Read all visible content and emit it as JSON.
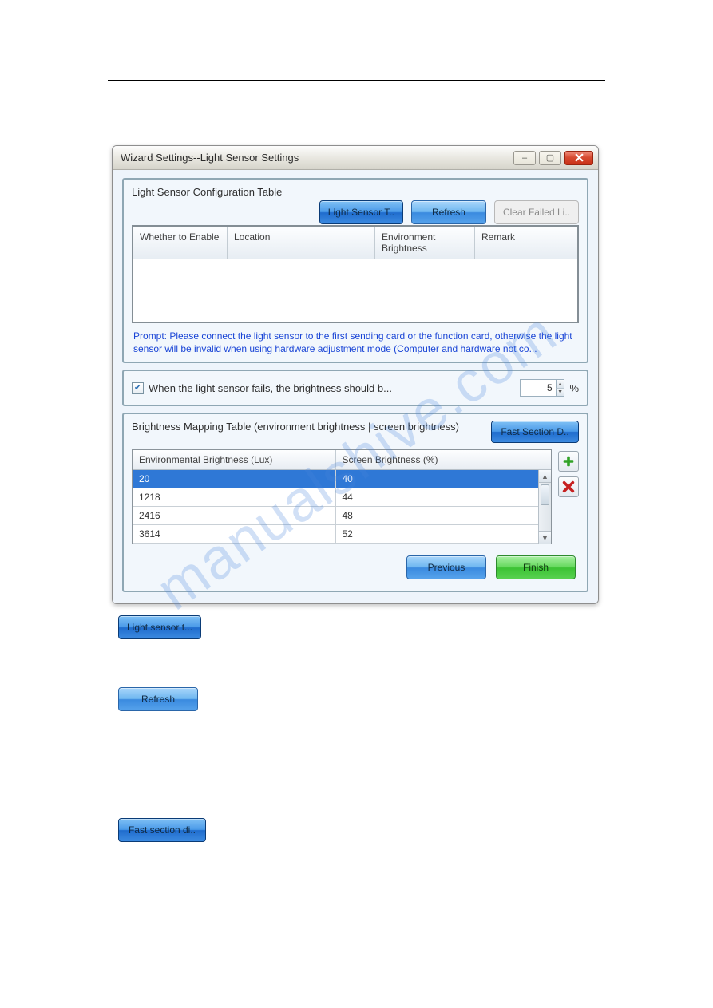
{
  "watermark": "manualshive.com",
  "dialog": {
    "title": "Wizard Settings--Light Sensor Settings",
    "window_controls": {
      "minimize": "–",
      "maximize": "▢",
      "close": "X"
    },
    "section1_title": "Light Sensor Configuration Table",
    "buttons": {
      "light_sensor_test": "Light Sensor T..",
      "refresh": "Refresh",
      "clear_failed": "Clear Failed Li.."
    },
    "config_table": {
      "headers": {
        "enable": "Whether to Enable",
        "location": "Location",
        "env": "Environment Brightness",
        "remark": "Remark"
      }
    },
    "prompt": "Prompt: Please connect the light sensor to the first sending card or the function card, otherwise the light sensor will be invalid when using hardware adjustment mode (Computer and hardware not co...",
    "fail_checkbox_checked": true,
    "fail_label": "When the light sensor fails, the brightness should b...",
    "fail_value": "5",
    "fail_unit": "%",
    "mapping_label": "Brightness Mapping Table (environment brightness | screen brightness)",
    "fast_section": "Fast Section D..",
    "mapping_table": {
      "headers": {
        "env": "Environmental Brightness (Lux)",
        "screen": "Screen Brightness (%)"
      },
      "rows": [
        {
          "env": "20",
          "screen": "40",
          "selected": true
        },
        {
          "env": "1218",
          "screen": "44",
          "selected": false
        },
        {
          "env": "2416",
          "screen": "48",
          "selected": false
        },
        {
          "env": "3614",
          "screen": "52",
          "selected": false
        }
      ]
    },
    "footer": {
      "previous": "Previous",
      "finish": "Finish"
    }
  },
  "inline_buttons": {
    "light_sensor_test": "Light sensor t...",
    "refresh": "Refresh",
    "fast_section": "Fast section di.."
  }
}
